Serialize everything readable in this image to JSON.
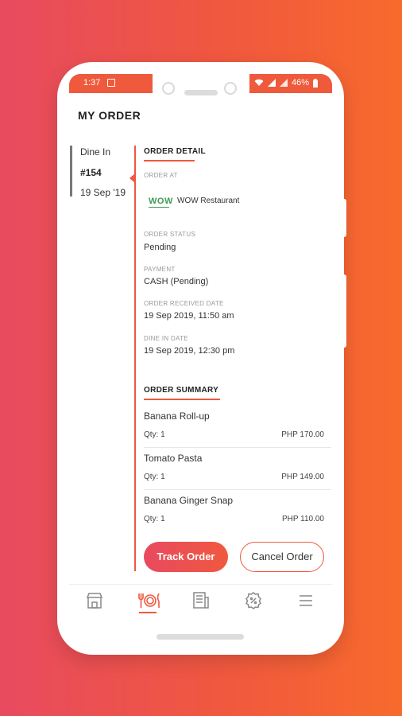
{
  "status_bar": {
    "time": "1:37",
    "battery": "46%"
  },
  "header": {
    "title": "MY ORDER"
  },
  "order_side": {
    "type": "Dine In",
    "number": "#154",
    "date": "19 Sep '19"
  },
  "order_detail": {
    "title": "ORDER DETAIL",
    "order_at_label": "ORDER AT",
    "logo_text": "WOW",
    "restaurant": "WOW Restaurant",
    "status_label": "ORDER STATUS",
    "status_value": "Pending",
    "payment_label": "PAYMENT",
    "payment_value": "CASH (Pending)",
    "received_label": "ORDER RECEIVED DATE",
    "received_value": "19 Sep 2019, 11:50 am",
    "dine_label": "DINE IN DATE",
    "dine_value": "19 Sep 2019, 12:30 pm"
  },
  "order_summary": {
    "title": "ORDER SUMMARY",
    "items": [
      {
        "name": "Banana Roll-up",
        "qty": "Qty: 1",
        "price": "PHP 170.00"
      },
      {
        "name": "Tomato Pasta",
        "qty": "Qty: 1",
        "price": "PHP 149.00"
      },
      {
        "name": "Banana Ginger Snap",
        "qty": "Qty: 1",
        "price": "PHP 110.00"
      }
    ]
  },
  "actions": {
    "track": "Track Order",
    "cancel": "Cancel Order"
  },
  "nav": {
    "items": [
      "store-icon",
      "dining-icon",
      "receipt-icon",
      "promo-icon",
      "menu-icon"
    ],
    "active": "dining-icon"
  },
  "colors": {
    "accent": "#f0583f",
    "gradient_start": "#e84a5f",
    "gradient_end": "#f86a2c",
    "logo_green": "#3f9b57"
  }
}
